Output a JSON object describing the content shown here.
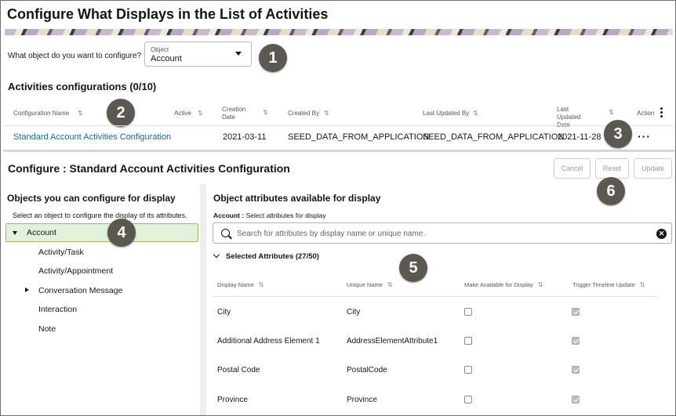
{
  "page": {
    "title": "Configure What Displays in the List of Activities"
  },
  "object_picker": {
    "question": "What object do you want to configure?",
    "label": "Object",
    "value": "Account"
  },
  "activities": {
    "title": "Activities configurations (0/10)",
    "columns": [
      "Configuration Name",
      "Active",
      "Creation Date",
      "Created By",
      "Last Updated By",
      "Last Updated Date",
      "Action"
    ],
    "row": {
      "name": "Standard Account Activities Configuration",
      "creation_date": "2021-03-11",
      "created_by": "SEED_DATA_FROM_APPLICATION",
      "last_updated_by": "SEED_DATA_FROM_APPLICATION",
      "last_updated_date": "2021-11-28",
      "action": "···"
    }
  },
  "configure": {
    "title": "Configure : Standard Account Activities Configuration",
    "buttons": {
      "cancel": "Cancel",
      "reset": "Reset",
      "update": "Update"
    }
  },
  "objects_panel": {
    "title": "Objects you can configure for display",
    "subtitle": "Select an object to configure the display of its attributes.",
    "items": [
      "Account",
      "Activity/Task",
      "Activity/Appointment",
      "Conversation Message",
      "Interaction",
      "Note"
    ]
  },
  "attributes_panel": {
    "title": "Object attributes available for display",
    "sub_bold": "Account :",
    "sub_text": "Select attributes for display",
    "search_placeholder": "Search for attributes by display name or unique name.",
    "selected_label": "Selected Attributes (27/50)",
    "columns": [
      "Display Name",
      "Unique Name",
      "Make Available for Display",
      "Trigger Timeline Update"
    ],
    "rows": [
      {
        "display": "City",
        "unique": "City",
        "available": false,
        "trigger": true
      },
      {
        "display": "Additional Address Element 1",
        "unique": "AddressElementAttribute1",
        "available": false,
        "trigger": true
      },
      {
        "display": "Postal Code",
        "unique": "PostalCode",
        "available": false,
        "trigger": true
      },
      {
        "display": "Province",
        "unique": "Province",
        "available": false,
        "trigger": true
      }
    ]
  },
  "callouts": [
    "1",
    "2",
    "3",
    "4",
    "5",
    "6"
  ],
  "colors": {
    "link": "#1b6a8a",
    "selected_bg": "#e4f1da",
    "badge": "#5d5752"
  }
}
